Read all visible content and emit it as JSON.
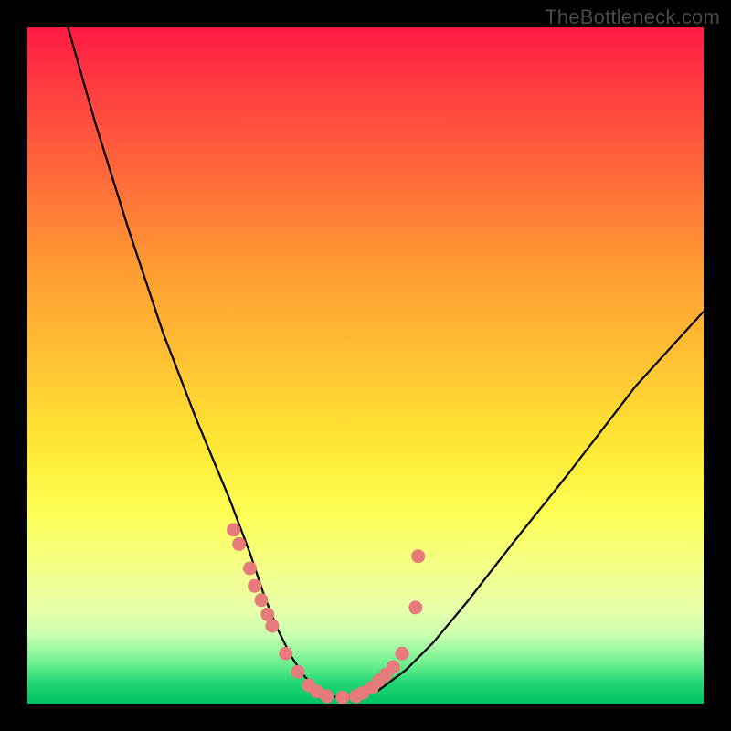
{
  "watermark": "TheBottleneck.com",
  "chart_data": {
    "type": "line",
    "title": "",
    "xlabel": "",
    "ylabel": "",
    "xlim": [
      0,
      100
    ],
    "ylim": [
      0,
      100
    ],
    "series": [
      {
        "name": "bottleneck-curve",
        "x": [
          6,
          10,
          15,
          20,
          25,
          30,
          33,
          35,
          37,
          39,
          41,
          43,
          45,
          48,
          52,
          56,
          60,
          65,
          72,
          80,
          90,
          100
        ],
        "y": [
          100,
          86,
          70,
          55,
          42,
          30,
          22,
          16,
          11,
          7,
          4,
          2,
          1,
          1,
          2,
          5,
          9,
          15,
          24,
          34,
          47,
          58
        ]
      }
    ],
    "markers": {
      "name": "data-points",
      "color": "#e77a7a",
      "x": [
        30.5,
        31.3,
        32.9,
        33.6,
        34.6,
        35.5,
        36.2,
        38.2,
        40.0,
        41.6,
        42.8,
        44.3,
        46.6,
        48.6,
        49.6,
        51.0,
        52.0,
        53.0,
        54.1,
        55.4,
        57.4,
        57.8
      ],
      "y": [
        25.7,
        23.6,
        20.0,
        17.4,
        15.3,
        13.2,
        11.5,
        7.4,
        4.7,
        2.7,
        1.8,
        1.1,
        0.9,
        1.1,
        1.6,
        2.4,
        3.4,
        4.3,
        5.4,
        7.4,
        14.2,
        21.8
      ]
    }
  }
}
